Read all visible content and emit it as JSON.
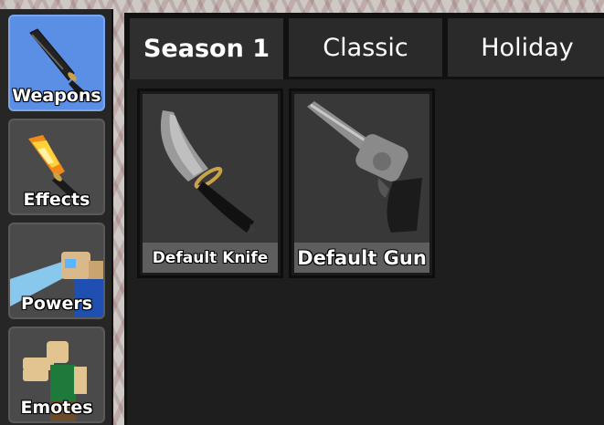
{
  "sidebar": {
    "items": [
      {
        "label": "Weapons",
        "icon": "knife-icon",
        "active": true
      },
      {
        "label": "Effects",
        "icon": "flame-knife-icon",
        "active": false
      },
      {
        "label": "Powers",
        "icon": "power-avatar-icon",
        "active": false
      },
      {
        "label": "Emotes",
        "icon": "dab-avatar-icon",
        "active": false
      }
    ]
  },
  "tabs": [
    {
      "label": "Season 1",
      "active": true
    },
    {
      "label": "Classic",
      "active": false
    },
    {
      "label": "Holiday",
      "active": false
    }
  ],
  "items": [
    {
      "name": "Default Knife",
      "icon": "default-knife-icon"
    },
    {
      "name": "Default Gun",
      "icon": "revolver-icon"
    }
  ],
  "colors": {
    "active_category": "#5b8fe6",
    "panel": "#1e1e1e",
    "card_label_bg": "#5e5e5e"
  }
}
